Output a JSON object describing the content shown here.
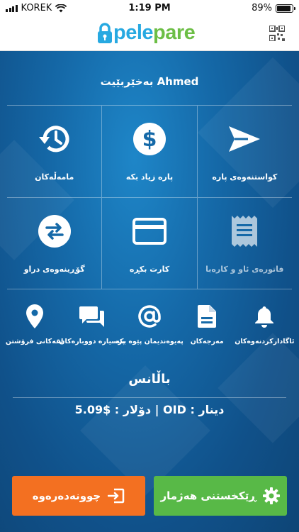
{
  "status_bar": {
    "carrier": "KOREK",
    "time": "1:19 PM",
    "battery": "89%",
    "battery_level": 0.89
  },
  "header": {
    "logo_part1": "pele",
    "logo_part2": "pare",
    "brand_colors": {
      "pele": "#27a9e1",
      "pare": "#6cbe45"
    }
  },
  "welcome": "بەخێربێیت Ahmed",
  "grid_rows": [
    [
      {
        "icon": "send-icon",
        "label": "کواستنەوەی پارە"
      },
      {
        "icon": "dollar-icon",
        "label": "پارە زیاد بکە"
      },
      {
        "icon": "history-icon",
        "label": "مامەڵەکان"
      }
    ],
    [
      {
        "icon": "receipt-icon",
        "label": "فاتورەی ئاو و کارەبا"
      },
      {
        "icon": "card-icon",
        "label": "کارت بکڕە"
      },
      {
        "icon": "exchange-icon",
        "label": "گۆڕینەوەی دراو"
      }
    ]
  ],
  "small_items": [
    {
      "icon": "bell-icon",
      "label": "ئاگادارکردنەوەکان"
    },
    {
      "icon": "document-icon",
      "label": "مەرجەکان"
    },
    {
      "icon": "at-icon",
      "label": "پەیوەندیمان پێوە بکە"
    },
    {
      "icon": "chat-icon",
      "label": "پرسیارە دووبارەکان"
    },
    {
      "icon": "location-icon",
      "label": "لقەکانی فرۆشتن"
    }
  ],
  "balance": {
    "title": "باڵانس",
    "line": "دینار : OID | دۆلار : $5.09"
  },
  "buttons": {
    "register": {
      "label": "ڕێکخستنی هەژمار",
      "icon": "gear-icon",
      "color": "#58b947"
    },
    "login": {
      "label": "چوونەدەرەوە",
      "icon": "logout-icon",
      "color": "#f37021"
    }
  }
}
